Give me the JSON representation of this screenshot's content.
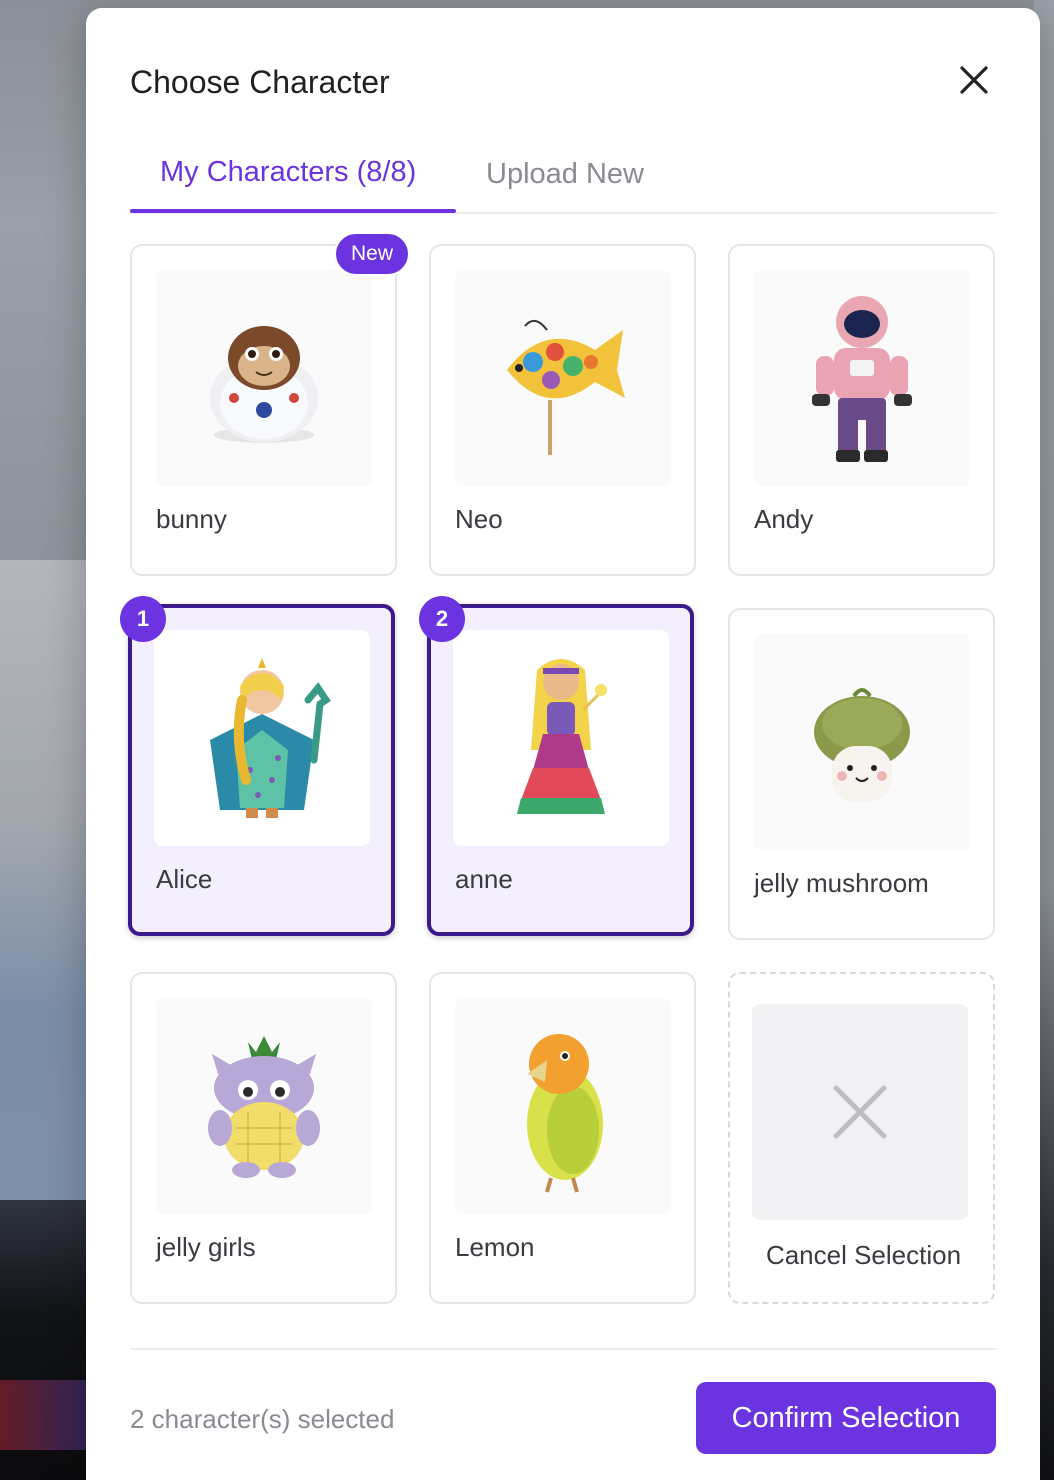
{
  "dialog": {
    "title": "Choose Character",
    "close_icon": "close-icon"
  },
  "tabs": [
    {
      "label": "My Characters (8/8)",
      "active": true
    },
    {
      "label": "Upload New",
      "active": false
    }
  ],
  "characters": [
    {
      "name": "bunny",
      "badge": "New",
      "selected": false,
      "image": "monkey-astronaut-toy"
    },
    {
      "name": "Neo",
      "selected": false,
      "image": "colorful-fish-on-stick"
    },
    {
      "name": "Andy",
      "selected": false,
      "image": "pink-astronaut-figure"
    },
    {
      "name": "Alice",
      "selected": true,
      "order": "1",
      "image": "princess-doll-blue-dress"
    },
    {
      "name": "anne",
      "selected": true,
      "order": "2",
      "image": "fairy-doll-rainbow-dress"
    },
    {
      "name": "jelly mushroom",
      "selected": false,
      "image": "plush-mushroom"
    },
    {
      "name": "jelly girls",
      "selected": false,
      "image": "purple-pineapple-owl-plush"
    },
    {
      "name": "Lemon",
      "selected": false,
      "image": "yellow-lovebird"
    }
  ],
  "cancel_option": {
    "label": "Cancel Selection",
    "icon": "x-icon"
  },
  "footer": {
    "selected_text": "2 character(s) selected",
    "confirm_label": "Confirm Selection"
  },
  "colors": {
    "accent": "#6b34e0",
    "selected_border": "#3b1a8e",
    "selected_bg": "#f3efff"
  }
}
